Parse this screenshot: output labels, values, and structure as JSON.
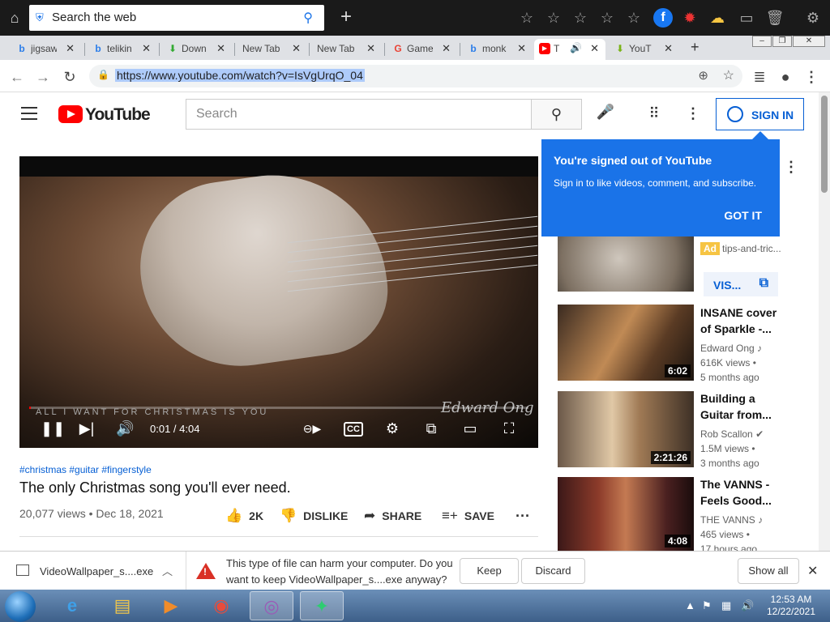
{
  "topbar": {
    "search_text": "Search the web",
    "tool_icons": [
      "star-icon",
      "star-icon",
      "star-icon",
      "star-icon",
      "star-icon",
      "facebook-icon",
      "bug-icon",
      "weather-icon",
      "folder-icon",
      "trash-icon",
      "gear-icon"
    ]
  },
  "tabs": [
    {
      "label": "jigsaw",
      "icon": "bing-icon"
    },
    {
      "label": "telikin",
      "icon": "bing-icon"
    },
    {
      "label": "Down",
      "icon": "download-icon"
    },
    {
      "label": "New Tab",
      "icon": ""
    },
    {
      "label": "New Tab",
      "icon": ""
    },
    {
      "label": "Game",
      "icon": "google-icon"
    },
    {
      "label": "monk",
      "icon": "bing-icon"
    },
    {
      "label": "T",
      "icon": "youtube-icon"
    },
    {
      "label": "YouT",
      "icon": "download-icon"
    }
  ],
  "address": {
    "url": "https://www.youtube.com/watch?v=IsVgUrqO_04"
  },
  "youtube": {
    "logo_word": "YouTube",
    "search_placeholder": "Search",
    "signin_label": "SIGN IN"
  },
  "popup": {
    "title": "You're signed out of YouTube",
    "desc": "Sign in to like videos, comment, and subscribe.",
    "button": "GOT IT"
  },
  "video": {
    "watermark_text": "ALL I WANT FOR CHRISTMAS IS YOU",
    "watermark_sig": "Edward Ong",
    "time": "0:01 / 4:04",
    "progress": 0.004,
    "hashtags": "#christmas #guitar #fingerstyle",
    "title": "The only Christmas song you'll ever need.",
    "views_date": "20,077 views • Dec 18, 2021",
    "actions": {
      "like": "2K",
      "dislike": "DISLIKE",
      "share": "SHARE",
      "save": "SAVE"
    }
  },
  "sidebar": {
    "ad": {
      "badge": "Ad",
      "source": "tips-and-tric...",
      "visit": "VIS..."
    },
    "items": [
      {
        "title": "INSANE cover of Sparkle -...",
        "channel": "Edward Ong",
        "views": "616K views •",
        "age": "5 months ago",
        "duration": "6:02"
      },
      {
        "title": "Building a Guitar from...",
        "channel": "Rob Scallon",
        "views": "1.5M views •",
        "age": "3 months ago",
        "duration": "2:21:26"
      },
      {
        "title": "The VANNS - Feels Good...",
        "channel": "THE VANNS",
        "views": "465 views •",
        "age": "17 hours ago",
        "duration": "4:08"
      }
    ]
  },
  "download": {
    "filename": "VideoWallpaper_s....exe",
    "message_line1": "This type of file can harm your computer. Do you",
    "message_line2": "want to keep VideoWallpaper_s....exe anyway?",
    "keep": "Keep",
    "discard": "Discard",
    "show_all": "Show all"
  },
  "taskbar": {
    "time": "12:53 AM",
    "date": "12/22/2021"
  }
}
